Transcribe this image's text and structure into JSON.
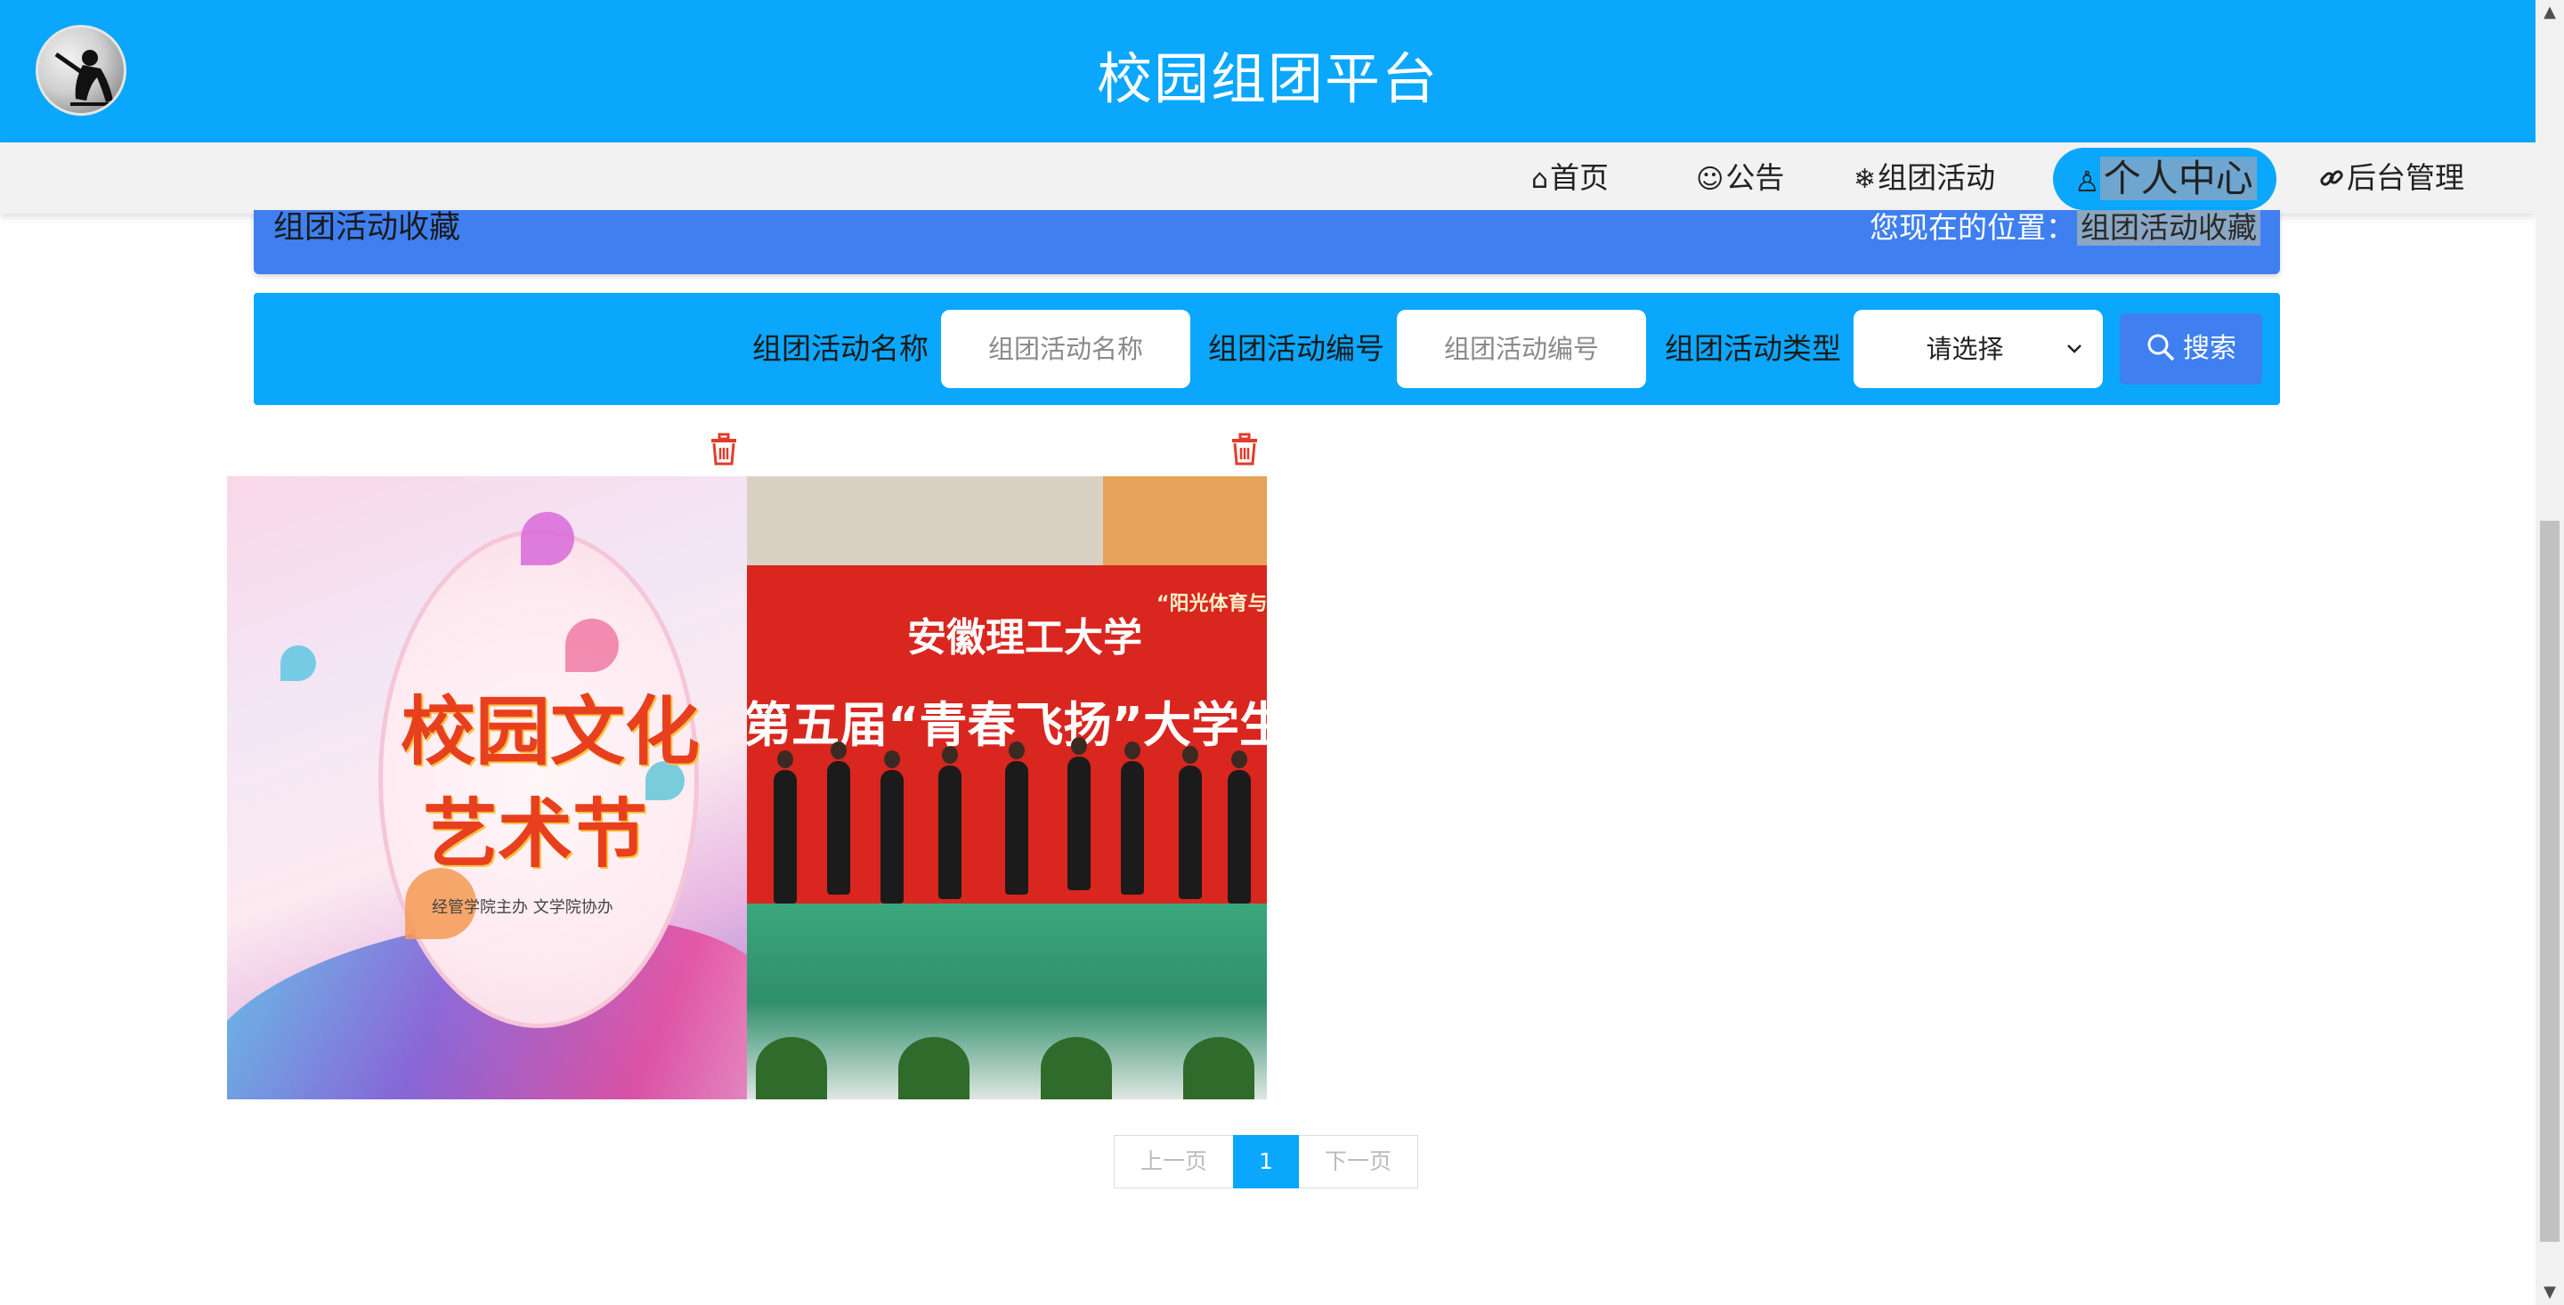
{
  "header": {
    "site_title": "校园组团平台",
    "logo_icon": "skater-avatar-icon"
  },
  "nav": {
    "items": [
      {
        "icon": "⌂",
        "icon_name": "home-icon",
        "label": "首页"
      },
      {
        "icon": "☺",
        "icon_name": "chat-icon",
        "label": "公告"
      },
      {
        "icon": "❄",
        "icon_name": "snowflake-icon",
        "label": "组团活动"
      },
      {
        "icon": "♙",
        "icon_name": "user-icon",
        "label": "个人中心",
        "active": true
      },
      {
        "icon": "🔗",
        "icon_name": "link-icon",
        "label": "后台管理"
      }
    ]
  },
  "breadcrumb": {
    "title": "组团活动收藏",
    "location_label": "您现在的位置：",
    "location_value": "组团活动收藏"
  },
  "search": {
    "name_label": "组团活动名称",
    "name_placeholder": "组团活动名称",
    "code_label": "组团活动编号",
    "code_placeholder": "组团活动编号",
    "type_label": "组团活动类型",
    "type_selected": "请选择",
    "button_label": "搜索"
  },
  "items": [
    {
      "image_name": "campus-culture-art-festival-poster",
      "text_line1": "校园文化",
      "text_line2": "艺术节",
      "subtext": "经管学院主办 文学院协办"
    },
    {
      "image_name": "dance-competition-photo",
      "university": "安徽理工大学",
      "slogan": "第五届“青春飞扬”大学生舞蹈大",
      "tag": "“阳光体育与奥运"
    }
  ],
  "pagination": {
    "prev_label": "上一页",
    "current_page": "1",
    "next_label": "下一页"
  },
  "colors": {
    "primary": "#0aa7fc",
    "accent_blue": "#3f7ff0",
    "delete_red": "#e23b2a"
  }
}
